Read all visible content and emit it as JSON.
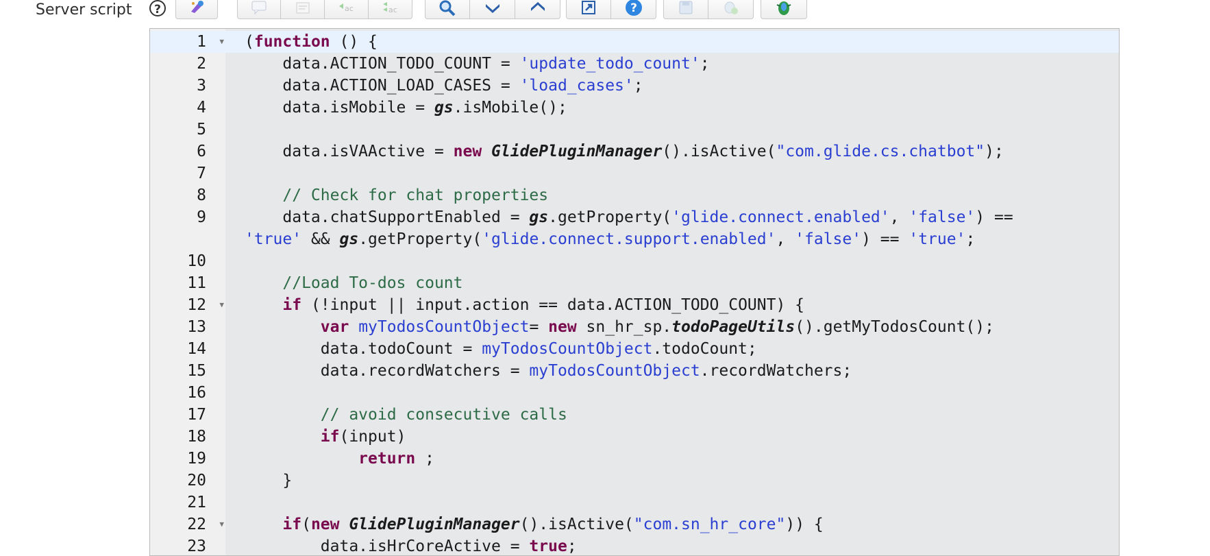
{
  "field": {
    "label": "Server script",
    "help": "?"
  },
  "editor": {
    "lines": [
      {
        "n": "1",
        "fold": true,
        "active": true,
        "html": "(<span class=\"kw\">function</span> () {"
      },
      {
        "n": "2",
        "html": "    data.ACTION_TODO_COUNT = <span class=\"str\">'update_todo_count'</span>;"
      },
      {
        "n": "3",
        "html": "    data.ACTION_LOAD_CASES = <span class=\"str\">'load_cases'</span>;"
      },
      {
        "n": "4",
        "html": "    data.isMobile = <span class=\"obj\">gs</span>.isMobile();"
      },
      {
        "n": "5",
        "html": ""
      },
      {
        "n": "6",
        "html": "    data.isVAActive = <span class=\"kw\">new</span> <span class=\"obj\">GlidePluginManager</span>().isActive(<span class=\"str\">\"com.glide.cs.chatbot\"</span>);"
      },
      {
        "n": "7",
        "html": ""
      },
      {
        "n": "8",
        "html": "    <span class=\"cmt\">// Check for chat properties</span>"
      },
      {
        "n": "9",
        "wrap": true,
        "html": "    data.chatSupportEnabled = <span class=\"obj\">gs</span>.getProperty(<span class=\"str\">'glide.connect.enabled'</span>, <span class=\"str\">'false'</span>) ==\n<span class=\"str\">'true'</span> &amp;&amp; <span class=\"obj\">gs</span>.getProperty(<span class=\"str\">'glide.connect.support.enabled'</span>, <span class=\"str\">'false'</span>) == <span class=\"str\">'true'</span>;"
      },
      {
        "n": "10",
        "html": ""
      },
      {
        "n": "11",
        "html": "    <span class=\"cmt\">//Load To-dos count</span>"
      },
      {
        "n": "12",
        "fold": true,
        "html": "    <span class=\"kw\">if</span> (!input || input.action == data.ACTION_TODO_COUNT) {"
      },
      {
        "n": "13",
        "html": "        <span class=\"kw\">var</span> <span class=\"var\">myTodosCountObject</span>= <span class=\"kw\">new</span> sn_hr_sp.<span class=\"obj\">todoPageUtils</span>().getMyTodosCount();"
      },
      {
        "n": "14",
        "html": "        data.todoCount = <span class=\"var\">myTodosCountObject</span>.todoCount;"
      },
      {
        "n": "15",
        "html": "        data.recordWatchers = <span class=\"var\">myTodosCountObject</span>.recordWatchers;"
      },
      {
        "n": "16",
        "html": ""
      },
      {
        "n": "17",
        "html": "        <span class=\"cmt\">// avoid consecutive calls</span>"
      },
      {
        "n": "18",
        "html": "        <span class=\"kw\">if</span>(input)"
      },
      {
        "n": "19",
        "html": "            <span class=\"kw\">return</span> ;"
      },
      {
        "n": "20",
        "html": "    }"
      },
      {
        "n": "21",
        "html": ""
      },
      {
        "n": "22",
        "fold": true,
        "html": "    <span class=\"kw\">if</span>(<span class=\"kw\">new</span> <span class=\"obj\">GlidePluginManager</span>().isActive(<span class=\"str\">\"com.sn_hr_core\"</span>)) {"
      },
      {
        "n": "23",
        "html": "        data.isHrCoreActive = <span class=\"kw\">true</span>;"
      }
    ]
  },
  "colors": {
    "keyword": "#7a0a4e",
    "string": "#2a3fd1",
    "comment": "#2d6b47",
    "active_line": "#e8f2ff"
  }
}
